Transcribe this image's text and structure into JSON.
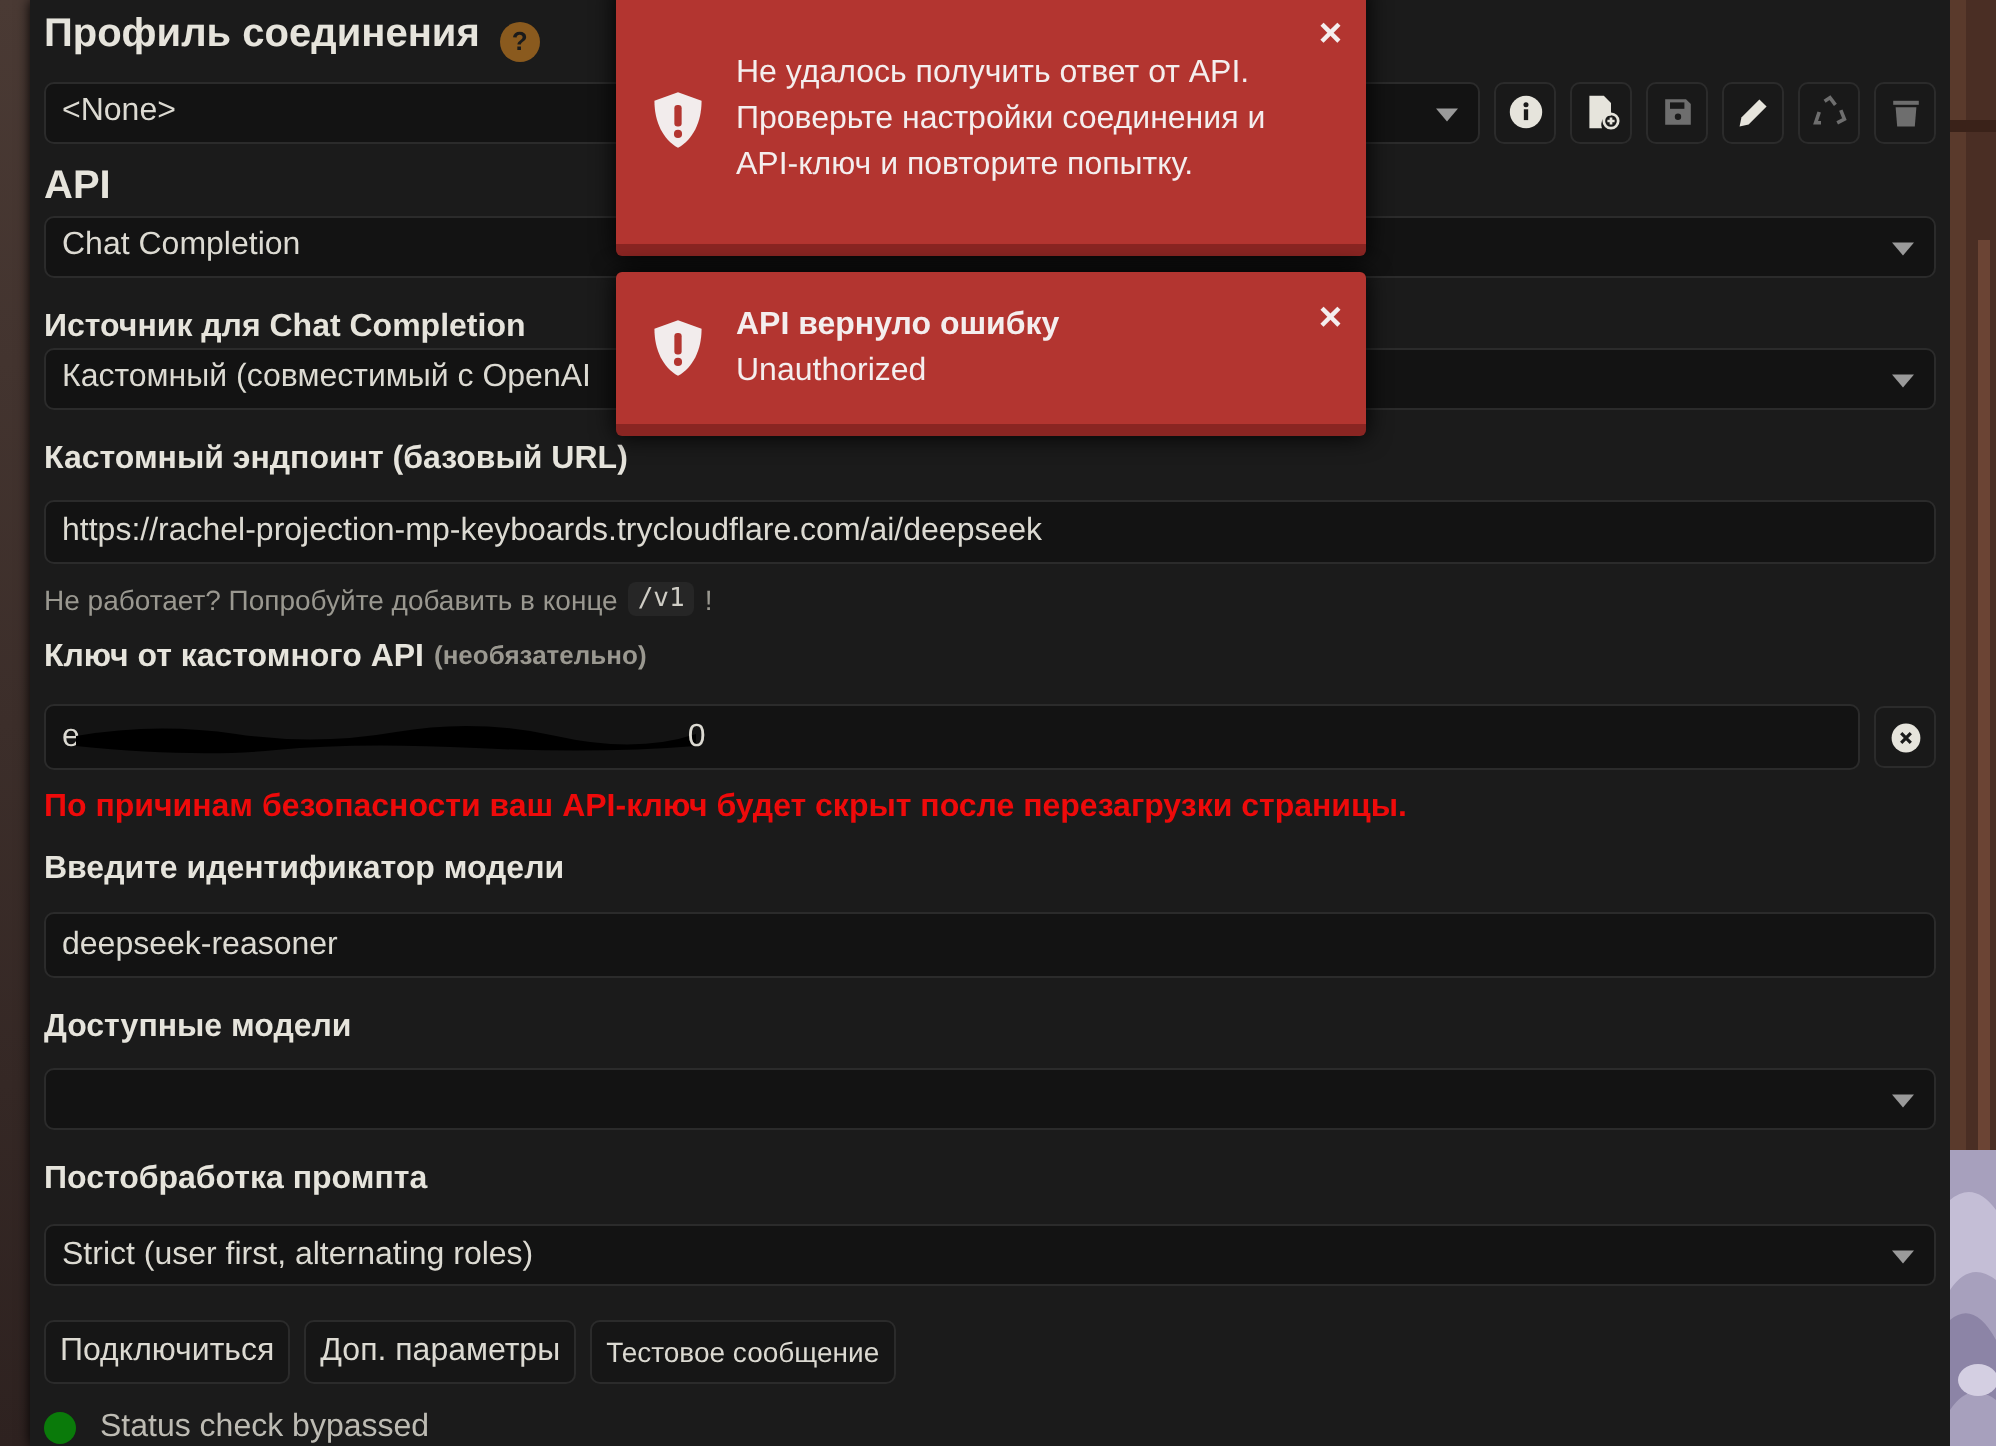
{
  "connection_profile": {
    "title": "Профиль соединения",
    "help": "?",
    "value": "<None>"
  },
  "api": {
    "label": "API",
    "value": "Chat Completion"
  },
  "source": {
    "label": "Источник для Chat Completion",
    "value": "Кастомный (совместимый с OpenAI"
  },
  "endpoint": {
    "label": "Кастомный эндпоинт (базовый URL)",
    "value": "https://rachel-projection-mp-keyboards.trycloudflare.com/ai/deepseek",
    "hint": "Не работает? Попробуйте добавить в конце",
    "hint_code": "/v1",
    "hint_end": "!"
  },
  "api_key": {
    "label": "Ключ от кастомного API",
    "label_note": "(необязательно)",
    "value_start": "e",
    "value_end": "0",
    "redacted": true,
    "warning": "По причинам безопасности ваш API-ключ будет скрыт после перезагрузки страницы."
  },
  "model_id": {
    "label": "Введите идентификатор модели",
    "value": "deepseek-reasoner"
  },
  "available_models": {
    "label": "Доступные модели"
  },
  "postprocessing": {
    "label": "Постобработка промпта",
    "value": "Strict (user first, alternating roles)"
  },
  "buttons": [
    "Подключиться",
    "Доп. параметры",
    "Тестовое сообщение"
  ],
  "status": {
    "text": "Status check bypassed",
    "color": "#0a7a0a"
  },
  "toasts": [
    {
      "message": "Не удалось получить ответ от API. Проверьте настройки соединения и API-ключ и повторите попытку.",
      "close": "×"
    },
    {
      "title": "API вернуло ошибку",
      "message": "Unauthorized",
      "close": "×"
    }
  ]
}
